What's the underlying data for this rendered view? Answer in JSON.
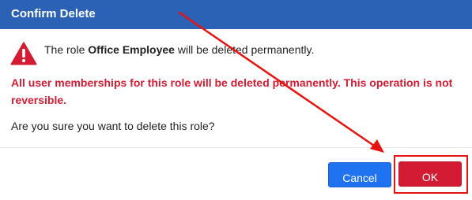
{
  "dialog": {
    "title": "Confirm Delete",
    "message_prefix": "The role ",
    "role_name": "Office Employee",
    "message_suffix": " will be deleted permanently.",
    "warning": "All user memberships for this role will be deleted permanently. This operation is not reversible.",
    "question": "Are you sure you want to delete this role?",
    "icon": "warning-triangle-icon"
  },
  "buttons": {
    "cancel_label": "Cancel",
    "ok_label": "OK"
  },
  "colors": {
    "header": "#2b62b6",
    "warning_red": "#d31c33",
    "cancel_blue": "#1f72f0",
    "annotation_red": "#e8120f"
  }
}
